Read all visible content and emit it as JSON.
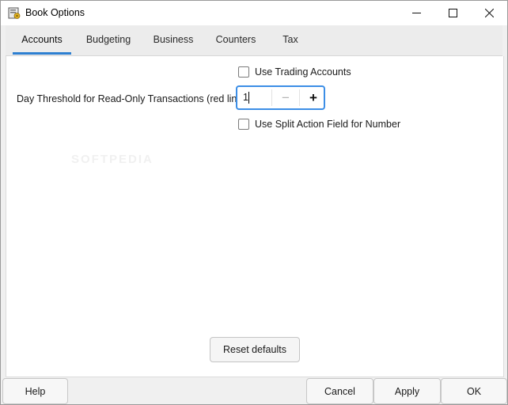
{
  "window": {
    "title": "Book Options",
    "icon": "book-options-icon",
    "controls": [
      "minimize-icon",
      "maximize-icon",
      "close-icon"
    ]
  },
  "tabs": [
    {
      "label": "Accounts",
      "active": true
    },
    {
      "label": "Budgeting",
      "active": false
    },
    {
      "label": "Business",
      "active": false
    },
    {
      "label": "Counters",
      "active": false
    },
    {
      "label": "Tax",
      "active": false
    }
  ],
  "accounts": {
    "use_trading_accounts": {
      "label": "Use Trading Accounts",
      "checked": false
    },
    "day_threshold": {
      "label": "Day Threshold for Read-Only Transactions (red line)",
      "value": "1",
      "decrement": "−",
      "increment": "+"
    },
    "use_split_action": {
      "label": "Use Split Action Field for Number",
      "checked": false
    }
  },
  "reset_button": "Reset defaults",
  "footer": {
    "help": "Help",
    "cancel": "Cancel",
    "apply": "Apply",
    "ok": "OK"
  },
  "watermark": "SOFTPEDIA",
  "colors": {
    "accent": "#2d7fd1",
    "focus_border": "#3c8ee6"
  }
}
